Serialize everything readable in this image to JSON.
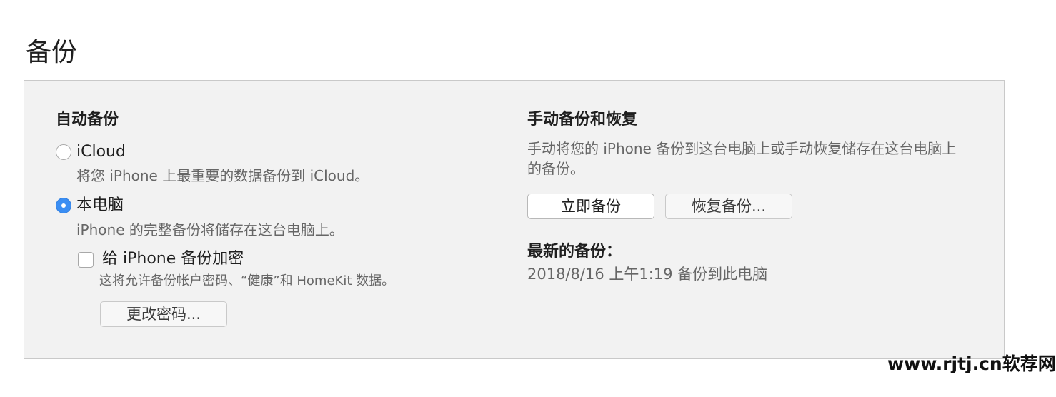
{
  "title": "备份",
  "auto_backup": {
    "heading": "自动备份",
    "options": [
      {
        "label": "iCloud",
        "description": "将您 iPhone 上最重要的数据备份到 iCloud。",
        "selected": false
      },
      {
        "label": "本电脑",
        "description": "iPhone 的完整备份将储存在这台电脑上。",
        "selected": true
      }
    ],
    "encrypt": {
      "label": "给 iPhone 备份加密",
      "checked": false,
      "description": "这将允许备份帐户密码、“健康”和 HomeKit 数据。"
    },
    "change_password_label": "更改密码..."
  },
  "manual_backup": {
    "heading": "手动备份和恢复",
    "description": "手动将您的 iPhone 备份到这台电脑上或手动恢复储存在这台电脑上的备份。",
    "backup_now_label": "立即备份",
    "restore_label": "恢复备份...",
    "latest_heading": "最新的备份：",
    "latest_value": "2018/8/16 上午1:19 备份到此电脑"
  },
  "colors": {
    "accent": "#3b8ef3",
    "panel_bg": "#f2f2f2",
    "secondary_text": "#666666"
  },
  "watermark": "www.rjtj.cn软荐网"
}
